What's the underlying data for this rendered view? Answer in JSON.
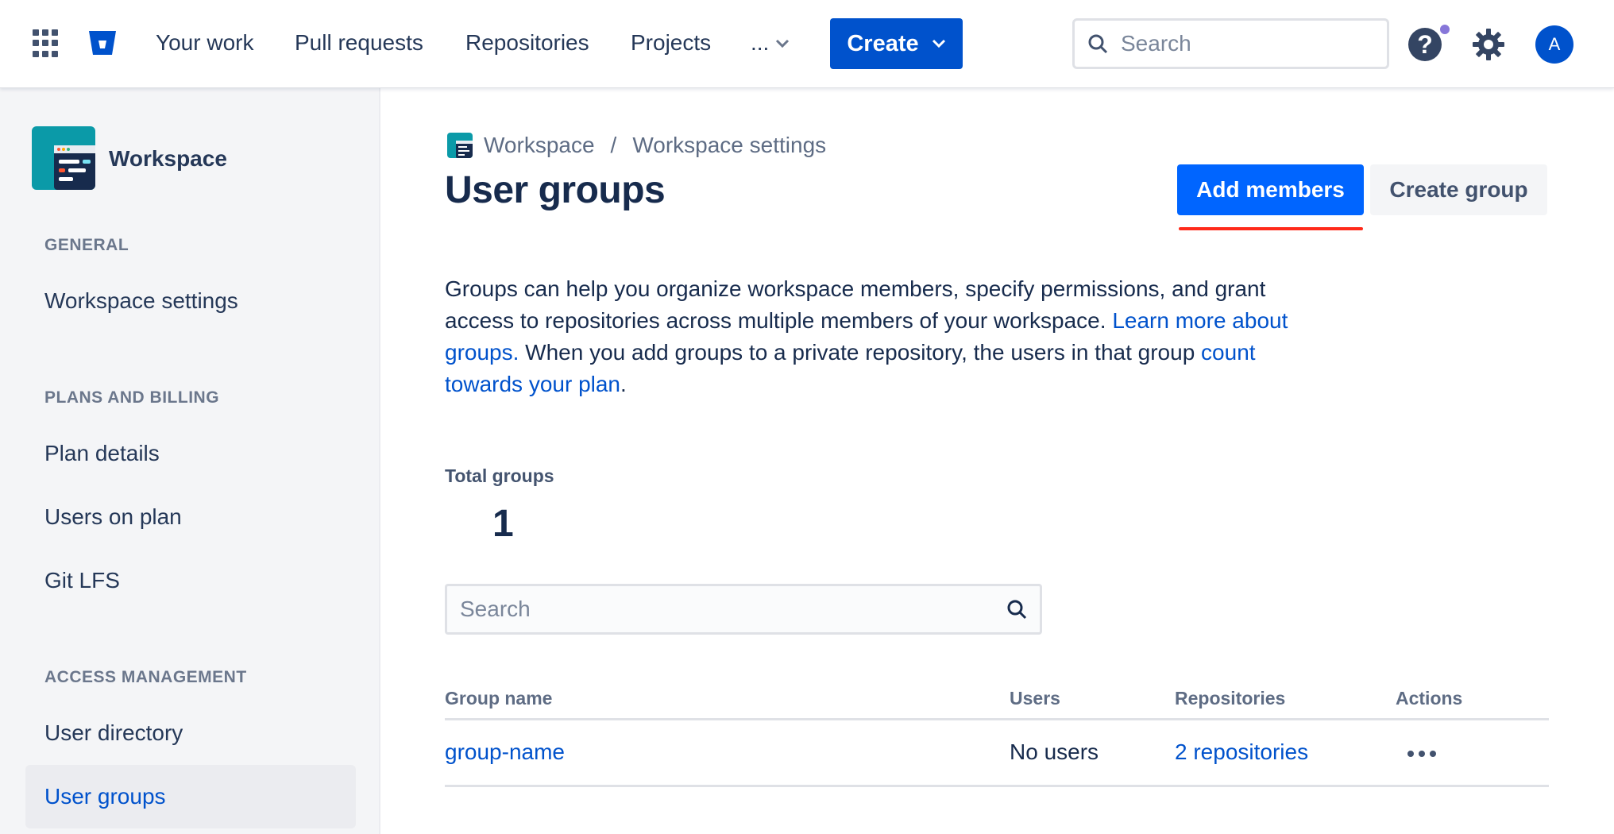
{
  "topnav": {
    "items": [
      "Your work",
      "Pull requests",
      "Repositories",
      "Projects"
    ],
    "more_label": "...",
    "create_label": "Create",
    "search_placeholder": "Search",
    "avatar_initial": "A"
  },
  "sidebar": {
    "workspace_name": "Workspace",
    "sections": [
      {
        "heading": "GENERAL",
        "items": [
          "Workspace settings"
        ]
      },
      {
        "heading": "PLANS AND BILLING",
        "items": [
          "Plan details",
          "Users on plan",
          "Git LFS"
        ]
      },
      {
        "heading": "ACCESS MANAGEMENT",
        "items": [
          "User directory",
          "User groups"
        ]
      }
    ],
    "active_item": "User groups"
  },
  "main": {
    "breadcrumb": [
      "Workspace",
      "/",
      "Workspace settings"
    ],
    "title": "User groups",
    "add_members_label": "Add members",
    "create_group_label": "Create group",
    "description": {
      "part1": "Groups can help you organize workspace members, specify permissions, and grant access to repositories across multiple members of your workspace. ",
      "link1": "Learn more about groups.",
      "part2": " When you add groups to a private repository, the users in that group ",
      "link2": "count towards your plan",
      "part3": "."
    },
    "total_label": "Total groups",
    "total_value": "1",
    "search_placeholder": "Search",
    "table": {
      "columns": [
        "Group name",
        "Users",
        "Repositories",
        "Actions"
      ],
      "rows": [
        {
          "group_name": "group-name",
          "users": "No users",
          "repositories": "2 repositories"
        }
      ]
    }
  },
  "colors": {
    "primary": "#0052cc",
    "primary_bright": "#0065ff",
    "highlight_underline": "#ff2a1a",
    "sidebar_bg": "#f4f5f7"
  }
}
